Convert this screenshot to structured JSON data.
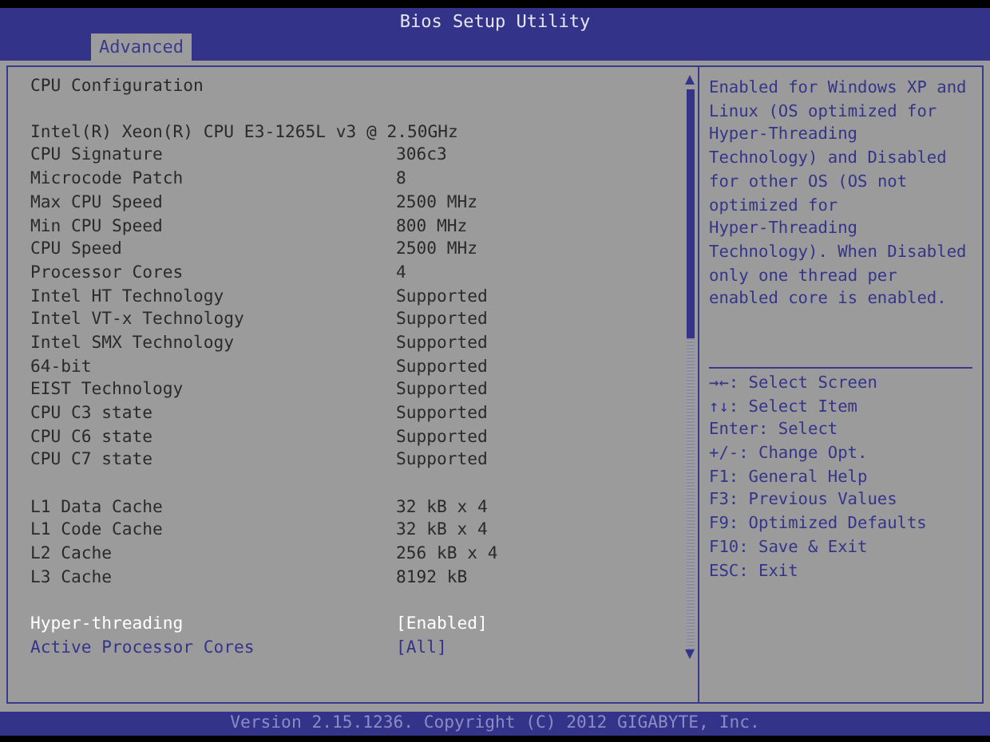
{
  "window": {
    "title": "Bios Setup Utility"
  },
  "tabs": [
    {
      "label": "Advanced",
      "selected": true
    }
  ],
  "main": {
    "heading": "CPU Configuration",
    "groups": [
      [
        {
          "kind": "info",
          "label": "Intel(R) Xeon(R) CPU E3-1265L v3 @ 2.50GHz"
        },
        {
          "kind": "info",
          "label": "CPU Signature",
          "value": "306c3"
        },
        {
          "kind": "info",
          "label": "Microcode Patch",
          "value": "8"
        },
        {
          "kind": "info",
          "label": "Max CPU Speed",
          "value": "2500 MHz"
        },
        {
          "kind": "info",
          "label": "Min CPU Speed",
          "value": "800 MHz"
        },
        {
          "kind": "info",
          "label": "CPU Speed",
          "value": "2500 MHz"
        },
        {
          "kind": "info",
          "label": "Processor Cores",
          "value": "4"
        },
        {
          "kind": "info",
          "label": "Intel HT Technology",
          "value": "Supported"
        },
        {
          "kind": "info",
          "label": "Intel VT-x Technology",
          "value": "Supported"
        },
        {
          "kind": "info",
          "label": "Intel SMX Technology",
          "value": "Supported"
        },
        {
          "kind": "info",
          "label": "64-bit",
          "value": "Supported"
        },
        {
          "kind": "info",
          "label": "EIST Technology",
          "value": "Supported"
        },
        {
          "kind": "info",
          "label": "CPU C3 state",
          "value": "Supported"
        },
        {
          "kind": "info",
          "label": "CPU C6 state",
          "value": "Supported"
        },
        {
          "kind": "info",
          "label": "CPU C7 state",
          "value": "Supported"
        }
      ],
      [
        {
          "kind": "info",
          "label": "L1 Data Cache",
          "value": "32 kB x 4"
        },
        {
          "kind": "info",
          "label": "L1 Code Cache",
          "value": "32 kB x 4"
        },
        {
          "kind": "info",
          "label": "L2 Cache",
          "value": "256 kB x 4"
        },
        {
          "kind": "info",
          "label": "L3 Cache",
          "value": "8192 kB"
        }
      ],
      [
        {
          "kind": "option",
          "label": "Hyper-threading",
          "value": "[Enabled]",
          "selected": true
        },
        {
          "kind": "option",
          "label": "Active Processor Cores",
          "value": "[All]",
          "selected": false
        }
      ]
    ]
  },
  "help": {
    "text": "Enabled for Windows XP and Linux (OS optimized for Hyper-Threading Technology) and Disabled for other OS (OS not optimized for Hyper-Threading Technology). When Disabled only one thread per enabled core is enabled.",
    "keys": [
      "→←: Select Screen",
      "↑↓: Select Item",
      "Enter: Select",
      "+/-: Change Opt.",
      "F1: General Help",
      "F3: Previous Values",
      "F9: Optimized Defaults",
      "F10: Save & Exit",
      "ESC: Exit"
    ]
  },
  "status_bar": "Version 2.15.1236. Copyright (C) 2012 GIGABYTE, Inc."
}
